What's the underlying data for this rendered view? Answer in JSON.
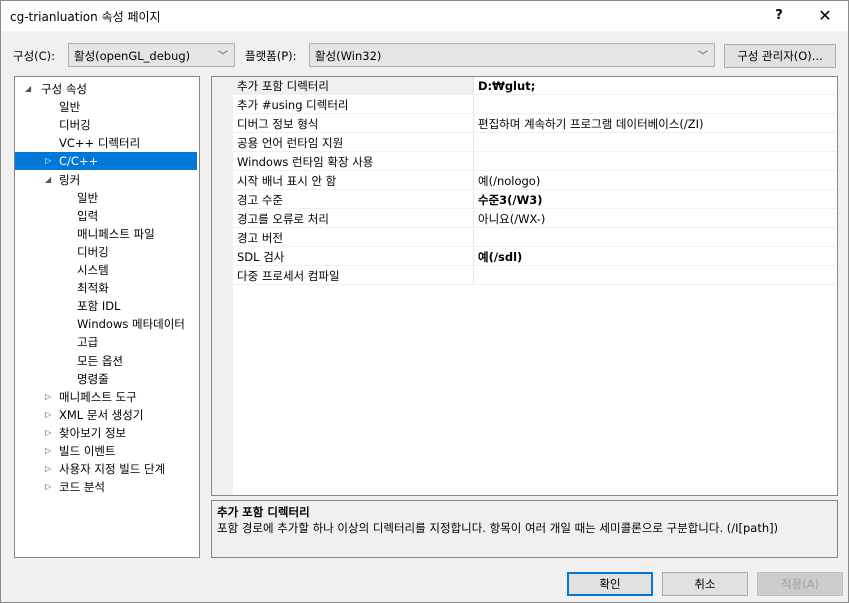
{
  "window": {
    "title": "cg-trianluation 속성 페이지",
    "help_label": "?",
    "close_label": "✕"
  },
  "config": {
    "label": "구성(C):",
    "value": "활성(openGL_debug)",
    "platform_label": "플랫폼(P):",
    "platform_value": "활성(Win32)",
    "manager_label": "구성 관리자(O)..."
  },
  "tree": {
    "items": [
      {
        "label": "구성 속성",
        "twisty": "◢"
      },
      {
        "label": "일반"
      },
      {
        "label": "디버깅"
      },
      {
        "label": "VC++ 디렉터리"
      },
      {
        "label": "C/C++",
        "twisty": "▷",
        "selected": true
      },
      {
        "label": "링커",
        "twisty": "◢"
      },
      {
        "label": "일반"
      },
      {
        "label": "입력"
      },
      {
        "label": "매니페스트 파일"
      },
      {
        "label": "디버깅"
      },
      {
        "label": "시스템"
      },
      {
        "label": "최적화"
      },
      {
        "label": "포함 IDL"
      },
      {
        "label": "Windows 메타데이터"
      },
      {
        "label": "고급"
      },
      {
        "label": "모든 옵션"
      },
      {
        "label": "명령줄"
      },
      {
        "label": "매니페스트 도구",
        "twisty": "▷"
      },
      {
        "label": "XML 문서 생성기",
        "twisty": "▷"
      },
      {
        "label": "찾아보기 정보",
        "twisty": "▷"
      },
      {
        "label": "빌드 이벤트",
        "twisty": "▷"
      },
      {
        "label": "사용자 지정 빌드 단계",
        "twisty": "▷"
      },
      {
        "label": "코드 분석",
        "twisty": "▷"
      }
    ]
  },
  "grid": {
    "rows": [
      {
        "name": "추가 포함 디렉터리",
        "value": "D:₩glut;",
        "bold": true,
        "selected": true
      },
      {
        "name": "추가 #using 디렉터리",
        "value": ""
      },
      {
        "name": "디버그 정보 형식",
        "value": "편집하며 계속하기 프로그램 데이터베이스(/ZI)"
      },
      {
        "name": "공용 언어 런타임 지원",
        "value": ""
      },
      {
        "name": "Windows 런타임 확장 사용",
        "value": ""
      },
      {
        "name": "시작 배너 표시 안 함",
        "value": "예(/nologo)"
      },
      {
        "name": "경고 수준",
        "value": "수준3(/W3)",
        "bold": true
      },
      {
        "name": "경고를 오류로 처리",
        "value": "아니요(/WX-)"
      },
      {
        "name": "경고 버전",
        "value": ""
      },
      {
        "name": "SDL 검사",
        "value": "예(/sdl)",
        "bold": true
      },
      {
        "name": "다중 프로세서 컴파일",
        "value": ""
      }
    ]
  },
  "description": {
    "title": "추가 포함 디렉터리",
    "text": "포함 경로에 추가할 하나 이상의 디렉터리를 지정합니다. 항목이 여러 개일 때는 세미콜론으로 구분합니다. (/I[path])"
  },
  "buttons": {
    "ok": "확인",
    "cancel": "취소",
    "apply": "적용(A)"
  },
  "colors": {
    "selection": "#0078d7",
    "dialog_bg": "#f0f0f0"
  }
}
